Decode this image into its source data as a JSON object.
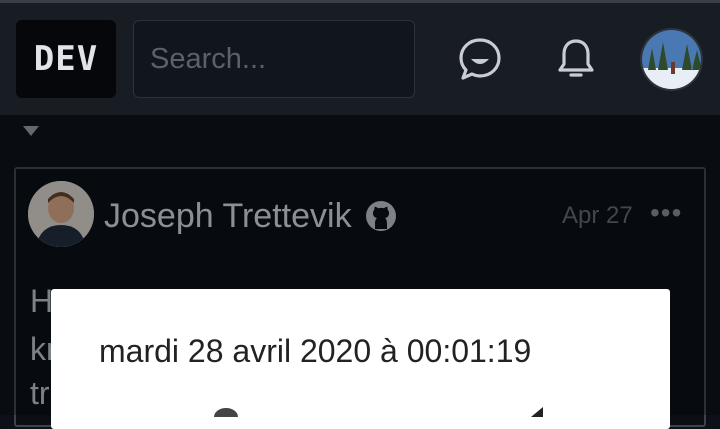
{
  "header": {
    "logo_text": "DEV",
    "search_placeholder": "Search...",
    "icons": [
      "chat-icon",
      "bell-icon",
      "avatar"
    ]
  },
  "feed": {
    "caret_icon": "caret-down-icon",
    "post": {
      "author": "Joseph Trettevik",
      "author_icon": "github-icon",
      "date": "Apr 27",
      "more_label": "•••",
      "body_fragments": [
        "H",
        "kr",
        "tr"
      ]
    }
  },
  "dialog": {
    "title": "mardi 28 avril 2020 à 00:01:19"
  },
  "colors": {
    "background": "#0d1117",
    "header": "#181d24",
    "dialog": "#ffffff"
  }
}
